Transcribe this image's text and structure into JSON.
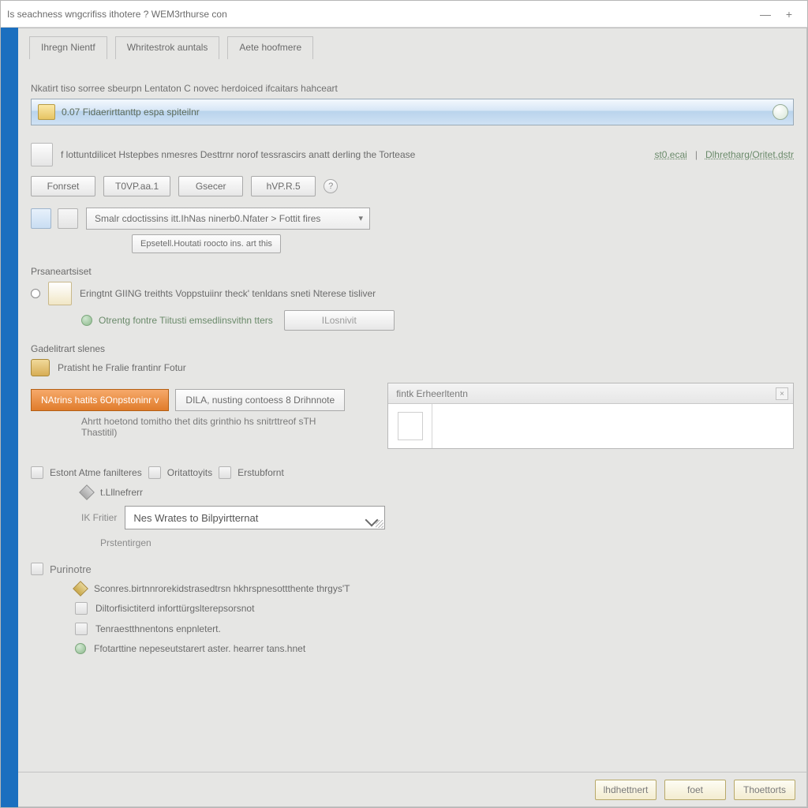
{
  "window": {
    "title": "Is seachness wngcrifiss ithotere ?  WEM3rthurse con"
  },
  "tabs": {
    "primary": "Ihregn Nientf",
    "secondary": "Whritestrok auntals",
    "tertiary": "Aete hoofmere"
  },
  "path": {
    "label": "Nkatirt tiso sorree sbeurpn Lentaton C novec herdoiced ifcaitars hahceart",
    "value": "0.07 Fidaerirttanttp espa spiteilnr"
  },
  "info": {
    "text": "f lottuntdilicet Hstepbes nmesres Desttrnr norof tessrascirs anatt derling the Tortease",
    "link1": "st0.ecai",
    "link2": "Dlhretharg/Oritet.dstr"
  },
  "buttons": {
    "b1": "Fonrset",
    "b2": "T0VP.aa.1",
    "b3": "Gsecer",
    "b4": "hVP.R.5"
  },
  "combo1": {
    "value": "Smalr cdoctissins itt.IhNas ninerb0.Nfater > Fottit fires",
    "below": "Epsetell.Houtati roocto ins. art this"
  },
  "param": {
    "title": "Prsaneartsiset",
    "line": "Eringtnt GIING treithts Voppstuiinr theck' tenldans sneti Nterese tisliver",
    "link": "Otrentg fontre Tiitusti emsedlinsvithn tters",
    "btn": "ILosnivit"
  },
  "grad": {
    "title": "Gadelitrart slenes",
    "line": "Pratisht he Fralie frantinr Fotur",
    "toggleA": "NAtrins hatits 6Onpstoninr v",
    "toggleB": "DILA, nusting contoess 8 Drihnnote",
    "desc": "Ahrtt hoetond tomitho thet dits grinthio hs snitrttreof sTH Thastitil)",
    "panelTitle": "fintk Erheerltentn"
  },
  "links": {
    "a": "Estont Atme fanilteres",
    "b": "Oritattoyits",
    "c": "Erstubfornt"
  },
  "kat": {
    "l1": "t.Lllnefrerr",
    "pre": "IK Fritier",
    "dd": "Nes Wrates to Bilpyirtternat",
    "l2": "Prstentirgen"
  },
  "endcat": {
    "title": "Purinotre",
    "line": "Sconres.birtnnrorekidstrasedtrsn hkhrspnesottthente thrgys'T",
    "s1": "Diltorfisictiterd inforttürgslterepsorsnot",
    "s2": "Tenraestthnentons enpnletert.",
    "s3": "Ffotarttine nepeseutstarert aster. hearrer tans.hnet"
  },
  "footer": {
    "b1": "lhdhettnert",
    "b2": "foet",
    "b3": "Thoettorts"
  }
}
